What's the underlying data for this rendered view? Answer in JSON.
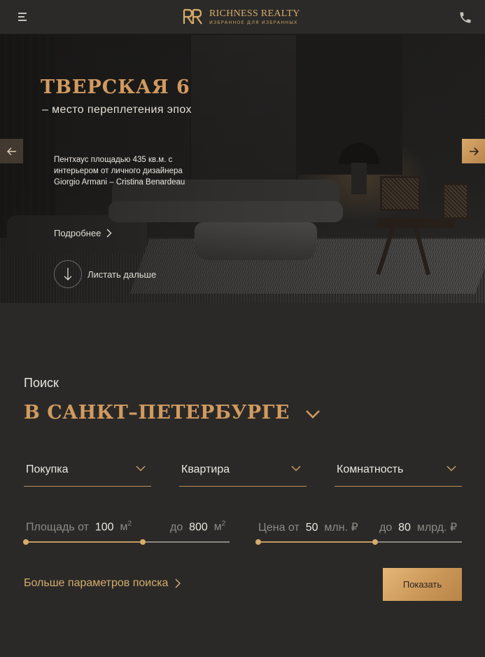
{
  "header": {
    "brand_name": "RICHNESS REALTY",
    "brand_tagline": "ИЗБРАННОЕ ДЛЯ ИЗБРАННЫХ",
    "menu_icon": "burger-menu-icon",
    "phone_icon": "phone-icon"
  },
  "hero": {
    "title": "ТВЕРСКАЯ 6",
    "subtitle": "– место переплетения эпох",
    "description": "Пентхаус площадью 435 кв.м. с интерьером от личного дизайнера Giorgio Armani – Cristina Benardeau",
    "more_link": "Подробнее",
    "scroll_label": "Листать дальше"
  },
  "search": {
    "label": "Поиск",
    "city": "В САНКТ–ПЕТЕРБУРГЕ",
    "selects": [
      {
        "label": "Покупка"
      },
      {
        "label": "Квартира"
      },
      {
        "label": "Комнатность"
      }
    ],
    "area": {
      "from_label": "Площадь от",
      "from_value": "100",
      "to_label": "до",
      "to_value": "800",
      "unit": "м",
      "unit_sup": "2"
    },
    "price": {
      "from_label": "Цена от",
      "from_value": "50",
      "from_unit": "млн. ₽",
      "to_label": "до",
      "to_value": "80",
      "to_unit": "млрд. ₽"
    },
    "more_params": "Больше параметров поиска",
    "submit": "Показать"
  },
  "colors": {
    "accent_gold": "#d19a5f",
    "background": "#2a2928",
    "text": "#e8e4dc"
  }
}
